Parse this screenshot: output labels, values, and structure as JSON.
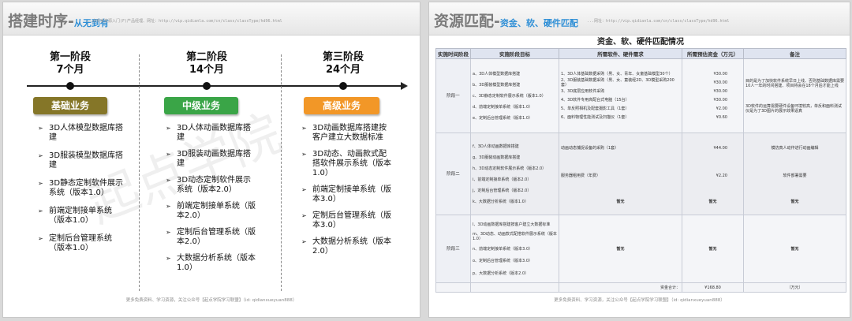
{
  "left": {
    "title_main": "搭建时序",
    "title_dash": "-",
    "title_sub": "从无到有",
    "header_url": "...点专家资源入门(F)产品经理、网址：http://vip.qidianla.com/cn/class/classType/hd96.html",
    "footer": "更多免费资料、学习资源，关注公众号【起点学院学习联盟】（id: qidianxueyuan888）",
    "watermark": "起点学院",
    "phases": [
      {
        "name": "第一阶段",
        "duration": "7个月",
        "button": "基础业务",
        "items": [
          "3D人体模型数据库搭建",
          "3D服装模型数据库搭建",
          "3D静态定制软件展示系统（版本1.0）",
          "前端定制接单系统（版本1.0）",
          "定制后台管理系统（版本1.0）"
        ]
      },
      {
        "name": "第二阶段",
        "duration": "14个月",
        "button": "中级业务",
        "items": [
          "3D人体动画数据库搭建",
          "3D服装动画数据库搭建",
          "3D动态定制软件展示系统（版本2.0）",
          "前端定制接单系统（版本2.0）",
          "定制后台管理系统（版本2.0）",
          "大数据分析系统（版本1.0）"
        ]
      },
      {
        "name": "第三阶段",
        "duration": "24个月",
        "button": "高级业务",
        "items": [
          "3D动画数据库搭建按客户建立大数据标准",
          "3D动态、动画款式配搭软件展示系统（版本1.0）",
          "前端定制接单系统（版本3.0）",
          "定制后台管理系统（版本3.0）",
          "大数据分析系统（版本2.0）"
        ]
      }
    ],
    "colors": {
      "basic": "#857628",
      "mid": "#3aa547",
      "adv": "#f29727"
    }
  },
  "right": {
    "title_main": "资源匹配",
    "title_dash": "-",
    "title_sub": "资金、软、硬件匹配",
    "header_url": "...网址：http://vip.qidianla.com/cn/class/classType/hd96.html",
    "footer": "更多免费资料、学习资源，关注公众号【起点学院学习联盟】（id: qidianxueyuan888）",
    "watermark": "起点学院",
    "table_title": "资金、软、硬件匹配情况",
    "headers": [
      "实施时间阶段",
      "实施阶段目标",
      "所需软件、硬件需求",
      "所需预估资金（万元）",
      "备注"
    ],
    "stages": [
      {
        "stage": "阶段一",
        "goals": [
          "a、3D人体模型数据库搭建",
          "b、3D服装模型数据库搭建",
          "c、3D静态定制软件展示系统（版本1.0）",
          "d、前端定制接单系统（版本1.0）",
          "e、定制后台管理系统（版本1.0）"
        ],
        "needs": [
          "1、3D人体基础数据采购（男、女、青年、女童基础模型30个）",
          "2、3D服装基础数据采购（男、女、童装经2D、3D模型采购200套）",
          "3、3D底层应用软件采购",
          "4、3D软件专用高配台式电脑（15台）",
          "5、单反照相机及配套摄影工具（1套）",
          "6、面料物理性能测试及扫描仪（1套）"
        ],
        "funds": [
          "¥30.00",
          "¥30.00",
          "¥30.00",
          "¥30.00",
          "¥2.00",
          "¥0.60"
        ],
        "notes": [
          "目的是为了加快软件系统早日上线、否则基础数据库需要10人一年的时间搭建、项目将会在18个月后才能上线",
          "3D软件的运算需要硬件设备环境较高，单反和面料测试仪是为了3D图片的展示效果逼真"
        ]
      },
      {
        "stage": "阶段二",
        "goals": [
          "f、3D人体动画数据库搭建",
          "g、3D服装动画数据库搭建",
          "h、3D动态定制软件展示系统（版本2.0）",
          "i、前端定制接单系统（版本2.0）",
          "j、定制后台管理系统（版本2.0）",
          "k、大数据分析系统（版本1.0）"
        ],
        "needs": [
          "动画动态捕捉设备的采购（1套）",
          "服务器租用费（年费）",
          "暂无"
        ],
        "funds": [
          "¥44.00",
          "¥2.20",
          "暂无"
        ],
        "notes": [
          "模仿真人动作进行动画编辑",
          "软件部署需要",
          "暂无"
        ]
      },
      {
        "stage": "阶段三",
        "goals": [
          "l、3D动画数据库搭建按客户建立大数据标准",
          "m、3D动态、动画款式配搭软件展示系统（版本1.0）",
          "n、前端定制接单系统（版本3.0）",
          "o、定制后台管理系统（版本3.0）",
          "p、大数据分析系统（版本2.0）"
        ],
        "needs": [
          "暂无"
        ],
        "funds": [
          "暂无"
        ],
        "notes": [
          "暂无"
        ]
      }
    ],
    "total_label": "资金合计：",
    "total_value": "¥168.80",
    "total_unit": "（万元）"
  }
}
